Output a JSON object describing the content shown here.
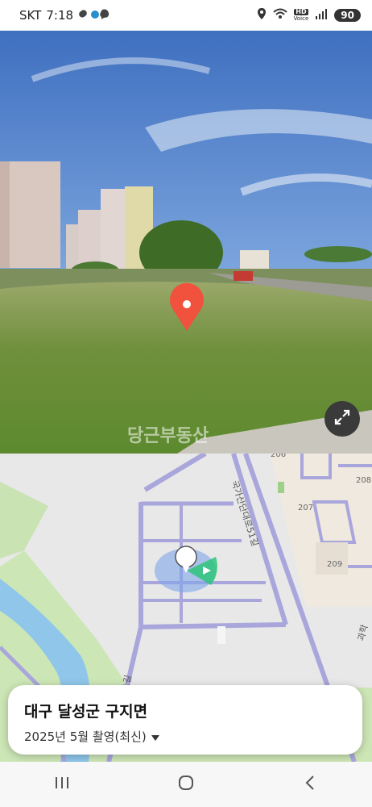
{
  "status_bar": {
    "carrier": "SKT",
    "time": "7:18",
    "hd_label": "HD",
    "voice_label": "Voice",
    "battery": "90"
  },
  "photo": {
    "watermark": "당근부동산"
  },
  "map": {
    "road_labels": [
      "국가산단대로51길",
      "국가산단대로51길"
    ],
    "building_numbers": [
      "206",
      "208",
      "207",
      "209"
    ],
    "small_label": "과학"
  },
  "card": {
    "title": "대구 달성군 구지면",
    "subtitle": "2025년 5월 촬영(최신)"
  },
  "colors": {
    "pin": "#f0523d",
    "accent_green": "#2ec47a",
    "road": "#a9a6dc"
  }
}
